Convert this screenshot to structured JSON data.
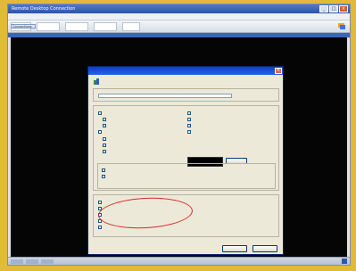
{
  "window": {
    "title": "Remote Desktop Connection",
    "controls": [
      "_",
      "□",
      "×"
    ]
  },
  "menubar": {
    "items": [
      "",
      "",
      "",
      ""
    ]
  },
  "toolbar": {
    "buttons": [
      {
        "label": "Connections"
      },
      {
        "label": "Default"
      },
      {
        "label": ""
      },
      {
        "label": ""
      },
      {
        "label": ""
      },
      {
        "label": ""
      }
    ],
    "logo_icon": "remote-desktop-logo-icon"
  },
  "dialog": {
    "title": "",
    "intro_text": "",
    "groups": {
      "top": {
        "label": "",
        "select_value": "",
        "side_label": ""
      },
      "general": {
        "label": ""
      },
      "advanced": {
        "label": ""
      },
      "other": {
        "label": ""
      }
    },
    "buttons": {
      "apply": "",
      "ok": "",
      "cancel": ""
    },
    "right_field_label": "",
    "pick_button": ""
  },
  "status": {
    "tray_text": ""
  },
  "colors": {
    "accent": "#2c55a8",
    "background": "#e3b93a",
    "dialog_bg": "#ece9d8",
    "annotation": "#d52a2a"
  }
}
